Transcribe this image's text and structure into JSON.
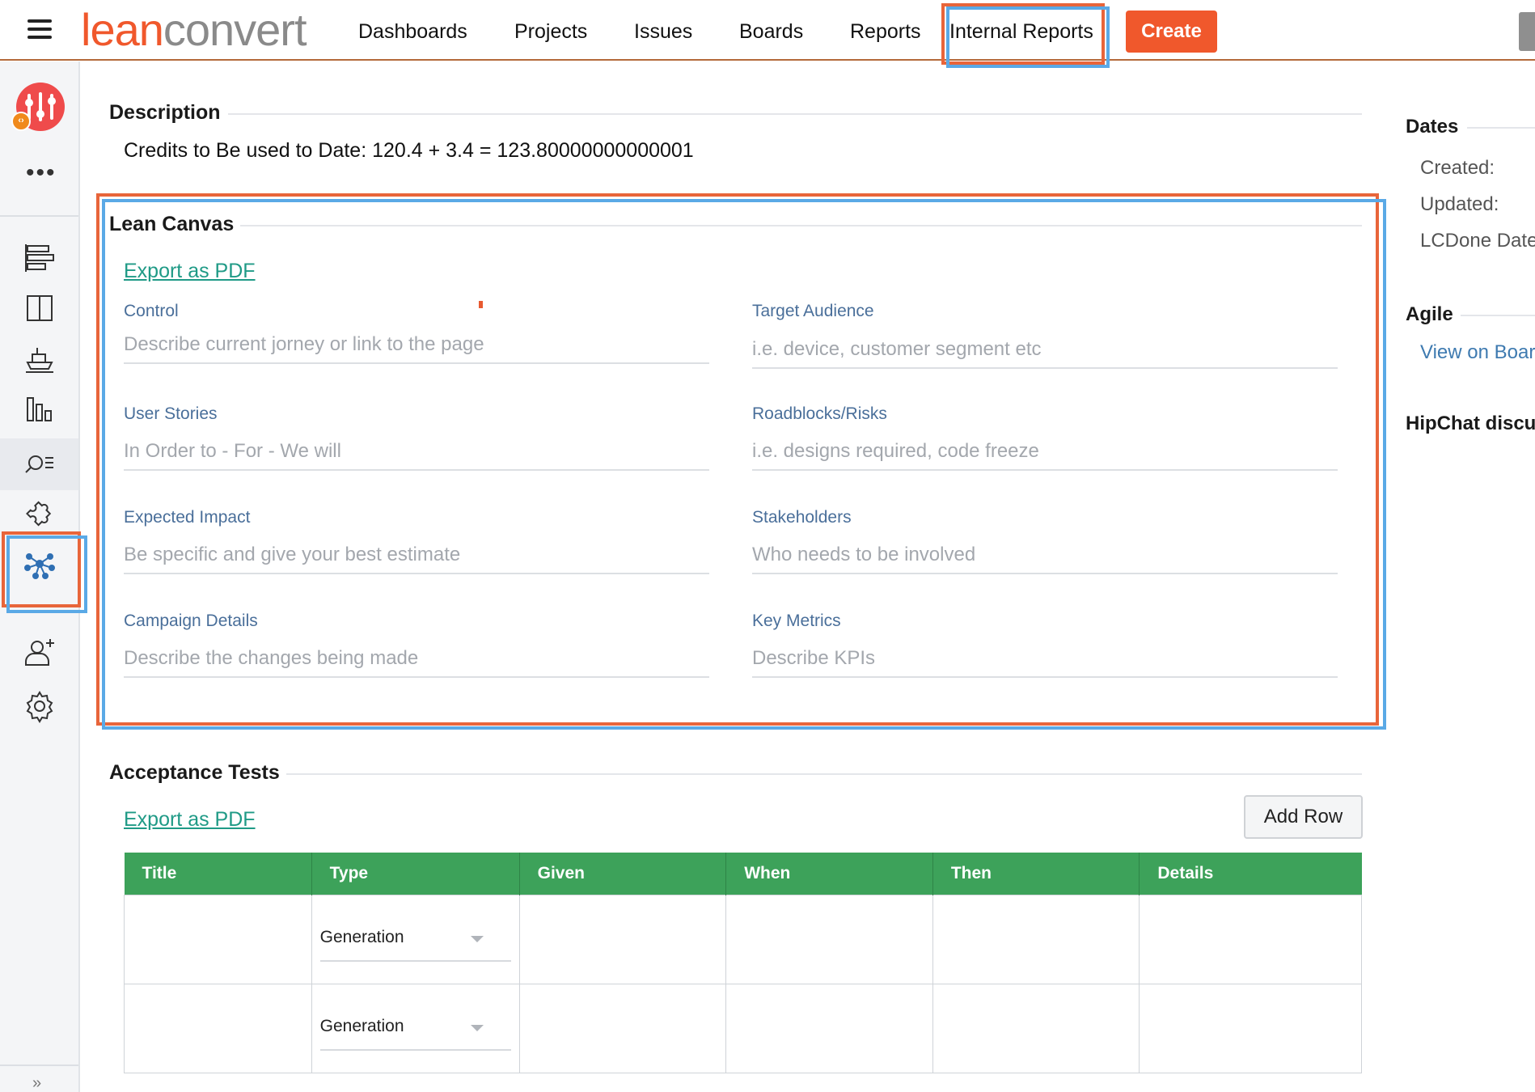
{
  "logo": {
    "part1": "lean",
    "part2": "convert"
  },
  "nav": {
    "items": [
      "Dashboards",
      "Projects",
      "Issues",
      "Boards",
      "Reports",
      "Internal Reports"
    ],
    "create_label": "Create"
  },
  "rail": {
    "app_badge": "‹›",
    "more": "•••",
    "collapse": "»",
    "icons": [
      "roadmap-icon",
      "board-icon",
      "ship-icon",
      "reports-icon",
      "search-list-icon",
      "puzzle-icon",
      "network-icon",
      "add-user-icon",
      "settings-icon"
    ]
  },
  "description": {
    "title": "Description",
    "text": "Credits to Be used to Date: 120.4 + 3.4 = 123.80000000000001"
  },
  "lean_canvas": {
    "title": "Lean Canvas",
    "export_label": "Export as PDF",
    "fields": [
      {
        "label": "Control",
        "placeholder": "Describe current jorney or link to the page"
      },
      {
        "label": "Target Audience",
        "placeholder": "i.e. device, customer segment etc"
      },
      {
        "label": "User Stories",
        "placeholder": "In Order to - For - We will"
      },
      {
        "label": "Roadblocks/Risks",
        "placeholder": "i.e. designs required, code freeze"
      },
      {
        "label": "Expected Impact",
        "placeholder": "Be specific and give your best estimate"
      },
      {
        "label": "Stakeholders",
        "placeholder": "Who needs to be involved"
      },
      {
        "label": "Campaign Details",
        "placeholder": "Describe the changes being made"
      },
      {
        "label": "Key Metrics",
        "placeholder": "Describe KPIs"
      }
    ]
  },
  "acceptance": {
    "title": "Acceptance Tests",
    "export_label": "Export as PDF",
    "add_row_label": "Add Row",
    "columns": [
      "Title",
      "Type",
      "Given",
      "When",
      "Then",
      "Details"
    ],
    "rows": [
      {
        "type": "Generation"
      },
      {
        "type": "Generation"
      }
    ]
  },
  "side": {
    "dates_title": "Dates",
    "created": "Created:",
    "updated": "Updated:",
    "lcdone": "LCDone Date",
    "agile_title": "Agile",
    "view_on_board": "View on Board",
    "hipchat_title": "HipChat discussions"
  },
  "colors": {
    "brand_orange": "#f0582c",
    "highlight_red": "#e8653a",
    "highlight_blue": "#5aa9e6",
    "table_header_green": "#3da25a",
    "link_teal": "#1f9a86"
  }
}
